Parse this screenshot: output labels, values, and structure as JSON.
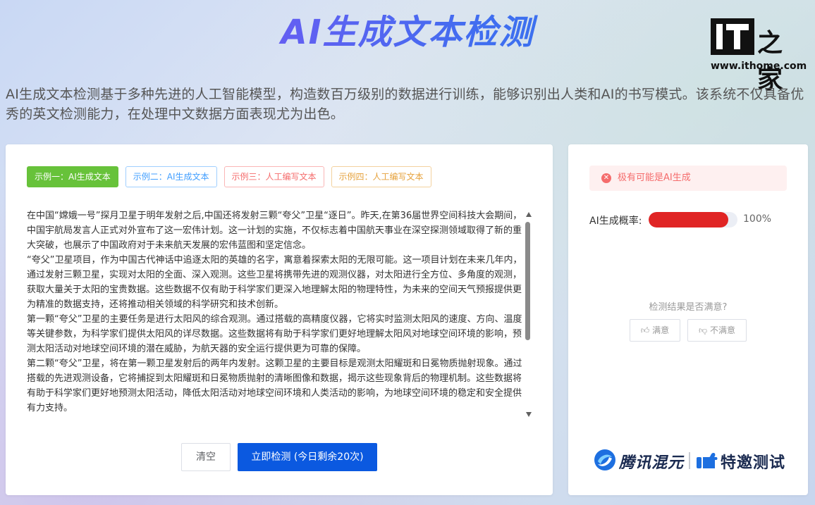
{
  "header": {
    "title": "AI生成文本检测",
    "logo_text": "IT之家",
    "logo_mark": "IT",
    "logo_chars": "之家",
    "logo_url": "www.ithome.com"
  },
  "description": "AI生成文本检测基于多种先进的人工智能模型，构造数百万级别的数据进行训练，能够识别出人类和AI的书写模式。该系统不仅具备优秀的英文检测能力，在处理中文数据方面表现尤为出色。",
  "tabs": [
    {
      "label": "示例一：AI生成文本",
      "state": "active"
    },
    {
      "label": "示例二：AI生成文本"
    },
    {
      "label": "示例三：人工编写文本"
    },
    {
      "label": "示例四：人工编写文本"
    }
  ],
  "input_text": "在中国“嫦娥一号”探月卫星于明年发射之后,中国还将发射三颗“夸父”卫星“逐日”。昨天,在第36届世界空间科技大会期间，中国宇航局发言人正式对外宣布了这一宏伟计划。这一计划的实施，不仅标志着中国航天事业在深空探测领域取得了新的重大突破，也展示了中国政府对于未来航天发展的宏伟蓝图和坚定信念。\n“夸父”卫星项目，作为中国古代神话中追逐太阳的英雄的名字，寓意着探索太阳的无限可能。这一项目计划在未来几年内，通过发射三颗卫星，实现对太阳的全面、深入观测。这些卫星将携带先进的观测仪器，对太阳进行全方位、多角度的观测，获取大量关于太阳的宝贵数据。这些数据不仅有助于科学家们更深入地理解太阳的物理特性，为未来的空间天气预报提供更为精准的数据支持，还将推动相关领域的科学研究和技术创新。\n第一颗“夸父”卫星的主要任务是进行太阳风的综合观测。通过搭载的高精度仪器，它将实时监测太阳风的速度、方向、温度等关键参数，为科学家们提供太阳风的详尽数据。这些数据将有助于科学家们更好地理解太阳风对地球空间环境的影响，预测太阳活动对地球空间环境的潜在威胁，为航天器的安全运行提供更为可靠的保障。\n第二颗“夸父”卫星，将在第一颗卫星发射后的两年内发射。这颗卫星的主要目标是观测太阳耀斑和日冕物质抛射现象。通过搭载的先进观测设备，它将捕捉到太阳耀斑和日冕物质抛射的清晰图像和数据，揭示这些现象背后的物理机制。这些数据将有助于科学家们更好地预测太阳活动，降低太阳活动对地球空间环境和人类活动的影响，为地球空间环境的稳定和安全提供有力支持。",
  "buttons": {
    "clear": "清空",
    "detect": "立即检测 (今日剩余20次)"
  },
  "result": {
    "alert": "极有可能是AI生成",
    "prob_label": "AI生成概率:",
    "prob_percent": 100,
    "prob_text": "100%",
    "satisfaction_question": "检测结果是否满意?",
    "feedback_good": "满意",
    "feedback_bad": "不满意"
  },
  "brand": {
    "name": "腾讯混元",
    "invite": "特邀测试"
  },
  "colors": {
    "title_gradient_start": "#8a4cf0",
    "title_gradient_end": "#2f7fe8",
    "primary": "#0b59e0",
    "success": "#67c23a",
    "danger": "#e02424"
  }
}
